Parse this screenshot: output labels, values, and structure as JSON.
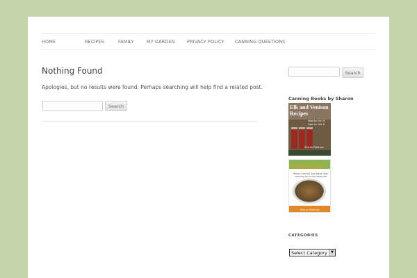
{
  "nav": {
    "items": [
      "HOME",
      "RECIPES",
      "FAMILY",
      "MY GARDEN",
      "PRIVACY POLICY",
      "CANNING QUESTIONS"
    ]
  },
  "main": {
    "title": "Nothing Found",
    "message": "Apologies, but no results were found. Perhaps searching will help find a related post.",
    "search_button": "Search",
    "search_value": ""
  },
  "sidebar": {
    "search_button": "Search",
    "search_value": "",
    "books_title": "Canning Books by Sharon",
    "book1": {
      "title": "Elk and Venison Recipes",
      "subtitle": "How to Can It How to Use It",
      "author": "Sharon Peterson"
    },
    "book2": {
      "title": "Simple Soups",
      "subtitle": "Home Canned Goodness from canning jar to the soup pot",
      "author": "Sharon Peterson"
    },
    "categories_title": "CATEGORIES",
    "categories_selected": "Select Category"
  },
  "colors": {
    "background": "#c6d3ad",
    "page": "#ffffff",
    "text": "#444444"
  }
}
